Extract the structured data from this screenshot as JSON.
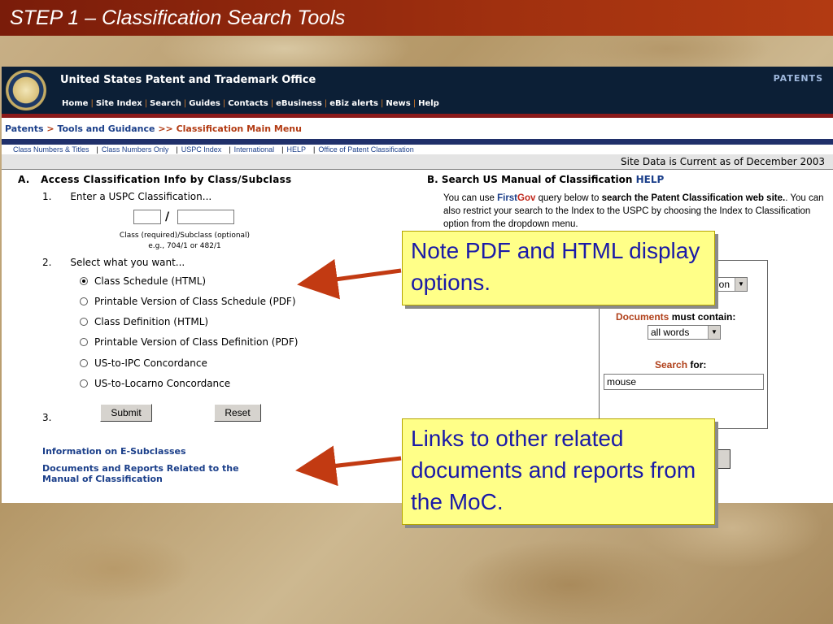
{
  "slide": {
    "title": "STEP 1 – Classification Search Tools"
  },
  "uspto": {
    "site_name": "United States Patent and Trademark Office",
    "section_tag": "PATENTS",
    "nav": [
      "Home",
      "Site Index",
      "Search",
      "Guides",
      "Contacts",
      "eBusiness",
      "eBiz alerts",
      "News",
      "Help"
    ]
  },
  "breadcrumb": {
    "item1": "Patents",
    "sep1": ">",
    "item2": "Tools and Guidance",
    "sep2": ">>",
    "current": "Classification Main Menu"
  },
  "sub_nav": [
    "Class Numbers & Titles",
    "Class Numbers Only",
    "USPC Index",
    "International",
    "HELP",
    "Office of Patent Classification"
  ],
  "currency_note": "Site Data is Current as of December 2003",
  "section_a": {
    "heading": "A.   Access Classification Info by Class/Subclass",
    "step1": "1.      Enter a USPC Classification...",
    "slash": "/",
    "class_hint": "Class (required)/Subclass (optional)",
    "example": "e.g., 704/1 or 482/1",
    "step2": "2.      Select what you want...",
    "options": [
      "Class Schedule (HTML)",
      "Printable Version of Class Schedule (PDF)",
      "Class Definition (HTML)",
      "Printable Version of Class Definition (PDF)",
      "US-to-IPC Concordance",
      "US-to-Locarno Concordance"
    ],
    "selected_option": "Class Schedule (HTML)",
    "step3": "3.",
    "submit": "Submit",
    "reset": "Reset",
    "link1": "Information on E-Subclasses",
    "link2_line1": "Documents and Reports Related to the",
    "link2_line2": "Manual of Classification"
  },
  "section_b": {
    "heading": "B. Search US Manual of Classification",
    "help": "HELP",
    "para_intro": "You can use",
    "first": "First",
    "gov": "Gov",
    "para_mid": "query below to",
    "para_bold": "search the Patent Classification web site.",
    "para_rest": ". You can also restrict your search to the Index to the USPC by choosing the Index to Classification option from the dropdown menu.",
    "scope_select_partial": "ion",
    "documents_word": "Documents",
    "must_contain": "must contain:",
    "match_select": "all words",
    "search_word": "Search",
    "for_word": "for:",
    "query": "mouse"
  },
  "callouts": {
    "note_pdf": "Note PDF and HTML display options.",
    "links_note": "Links to other related documents and reports from the MoC."
  },
  "colors": {
    "title_bar": "#a0300f",
    "callout_fill": "#ffff88",
    "callout_text": "#1a1aa8",
    "arrow": "#c23a12",
    "uspto_header": "#0c1f36"
  }
}
